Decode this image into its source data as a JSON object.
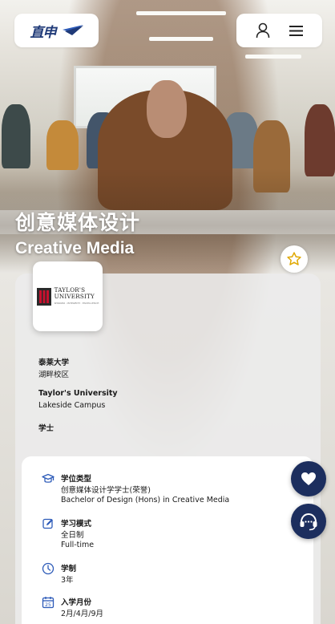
{
  "header": {
    "logo_text": "直申",
    "logo_icon": "paper-plane-logo-icon",
    "user_icon": "user-icon",
    "menu_icon": "menu-icon"
  },
  "hero": {
    "title_zh": "创意媒体设计",
    "title_en": "Creative Media",
    "favorite_icon": "star-icon"
  },
  "institution": {
    "logo_name_line1": "TAYLOR'S",
    "logo_name_line2": "UNIVERSITY",
    "logo_tagline": "WISDOM · INTEGRITY · EXCELLENCE",
    "name_zh": "泰莱大学",
    "campus_zh": "湖畔校区",
    "name_en": "Taylor's University",
    "campus_en": "Lakeside Campus",
    "degree_level": "学士"
  },
  "details": [
    {
      "icon": "graduation-cap-icon",
      "label": "学位类型",
      "values": [
        "创意媒体设计学学士(荣誉)",
        "Bachelor of Design (Hons) in Creative Media"
      ]
    },
    {
      "icon": "edit-icon",
      "label": "学习模式",
      "values": [
        "全日制",
        "Full-time"
      ]
    },
    {
      "icon": "clock-icon",
      "label": "学制",
      "values": [
        "3年"
      ]
    },
    {
      "icon": "calendar-icon",
      "label": "入学月份",
      "values": [
        "2月/4月/9月"
      ]
    }
  ],
  "floating": {
    "favorite_icon": "heart-icon",
    "support_icon": "headset-icon"
  },
  "colors": {
    "brand_navy": "#1c2e5e",
    "star_gold": "#e0a800",
    "accent_blue": "#2c5ab8"
  }
}
